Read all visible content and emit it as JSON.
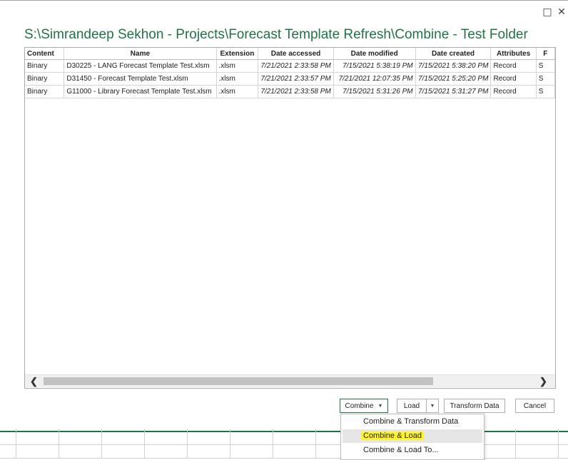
{
  "window": {
    "maximize_icon": "□",
    "close_icon": "✕"
  },
  "title": "S:\\Simrandeep Sekhon - Projects\\Forecast Template Refresh\\Combine - Test Folder",
  "table": {
    "columns": [
      "Content",
      "Name",
      "Extension",
      "Date accessed",
      "Date modified",
      "Date created",
      "Attributes",
      "F"
    ],
    "rows": [
      [
        "Binary",
        "D30225 - LANG Forecast Template Test.xlsm",
        ".xlsm",
        "7/21/2021 2:33:58 PM",
        "7/15/2021 5:38:19 PM",
        "7/15/2021 5:38:20 PM",
        "Record",
        "S"
      ],
      [
        "Binary",
        "D31450 - Forecast Template Test.xlsm",
        ".xlsm",
        "7/21/2021 2:33:57 PM",
        "7/21/2021 12:07:35 PM",
        "7/15/2021 5:25:20 PM",
        "Record",
        "S"
      ],
      [
        "Binary",
        "G11000 - Library Forecast Template Test.xlsm",
        ".xlsm",
        "7/21/2021 2:33:58 PM",
        "7/15/2021 5:31:26 PM",
        "7/15/2021 5:31:27 PM",
        "Record",
        "S"
      ]
    ]
  },
  "scrollbar": {
    "left_arrow": "❮",
    "right_arrow": "❯"
  },
  "buttons": {
    "combine": "Combine",
    "load": "Load",
    "transform": "Transform Data",
    "cancel": "Cancel",
    "caret": "▼"
  },
  "combine_menu": {
    "items": [
      "Combine & Transform Data",
      "Combine & Load",
      "Combine & Load To..."
    ],
    "highlight_color": "#fff32a"
  },
  "colors": {
    "title": "#217346",
    "accent": "#217346"
  }
}
